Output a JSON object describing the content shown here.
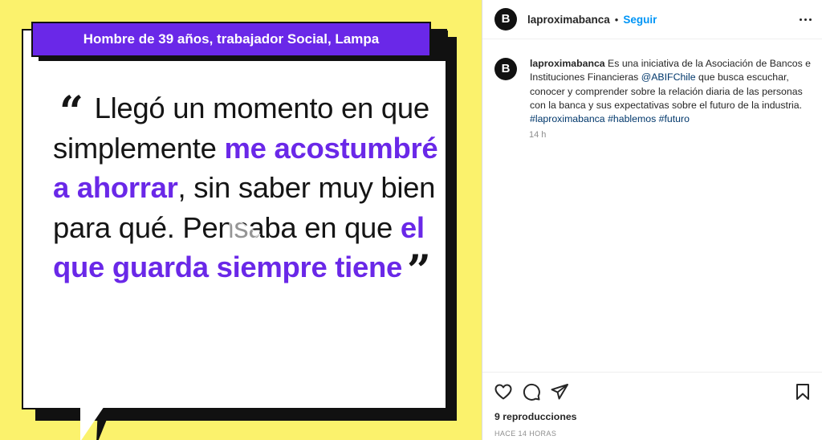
{
  "post": {
    "banner_text": "Hombre de 39 años, trabajador Social, Lampa",
    "quote_segments": [
      "Llegó un momento en que simplemente ",
      "me acostumbré a ahorrar",
      ", sin saber muy bien para qué. Pensaba en que ",
      "el que guarda siempre tiene"
    ],
    "open_mark": "“",
    "close_mark": "”",
    "colors": {
      "background": "#fbf26c",
      "accent": "#6a28e8",
      "card": "#ffffff",
      "ink": "#111111"
    },
    "play_icon": "play-icon"
  },
  "header": {
    "avatar_letter": "B",
    "username": "laproximabanca",
    "separator": "•",
    "follow_label": "Seguir",
    "more_icon": "more-horizontal-icon"
  },
  "caption": {
    "avatar_letter": "B",
    "author": "laproximabanca",
    "text_1": " Es una iniciativa de la Asociación de Bancos e Instituciones Financieras ",
    "mention": "@ABIFChile",
    "text_2": " que busca escuchar, conocer y comprender sobre la relación diaria de las personas con la banca y sus expectativas sobre el futuro de la industria.",
    "hashtag_1": "#laproximabanca",
    "hashtag_2": "#hablemos",
    "hashtag_3": "#futuro",
    "time": "14 h"
  },
  "actions": {
    "icons": [
      "heart-icon",
      "comment-icon",
      "share-icon",
      "bookmark-icon"
    ],
    "views": "9 reproducciones",
    "posted_ago": "HACE 14 HORAS"
  }
}
